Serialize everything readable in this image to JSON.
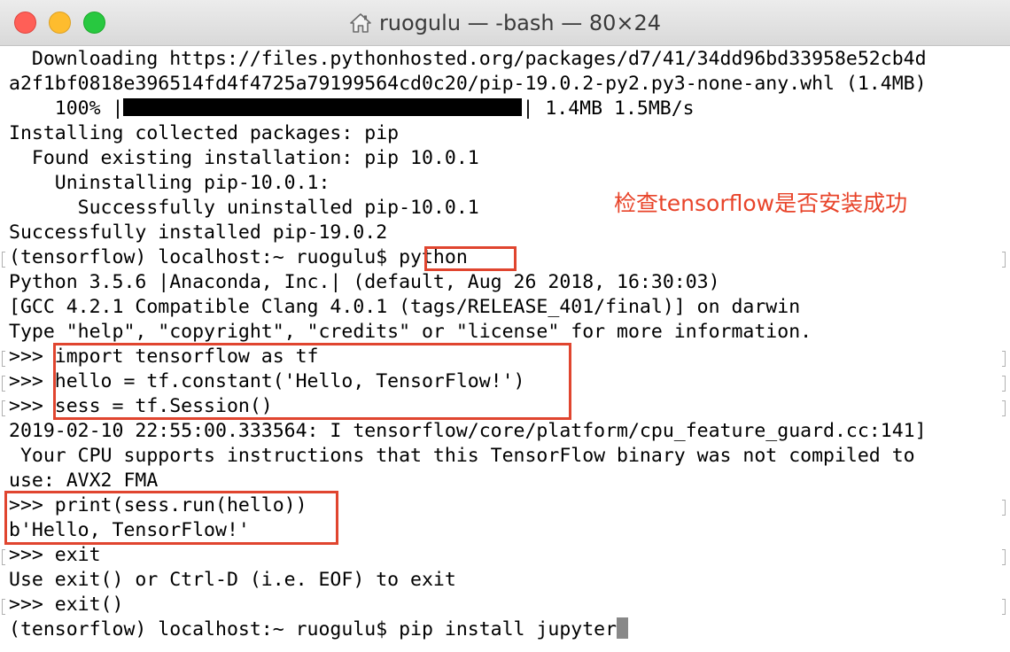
{
  "window": {
    "title": "ruogulu — -bash — 80×24",
    "title_icon": "home-icon"
  },
  "terminal": {
    "lines": [
      "  Downloading https://files.pythonhosted.org/packages/d7/41/34dd96bd33958e52cb4d",
      "a2f1bf0818e396514fd4f4725a79199564cd0c20/pip-19.0.2-py2.py3-none-any.whl (1.4MB)",
      "",
      "Installing collected packages: pip",
      "  Found existing installation: pip 10.0.1",
      "    Uninstalling pip-10.0.1:",
      "      Successfully uninstalled pip-10.0.1",
      "Successfully installed pip-19.0.2",
      "(tensorflow) localhost:~ ruogulu$ python",
      "Python 3.5.6 |Anaconda, Inc.| (default, Aug 26 2018, 16:30:03)",
      "[GCC 4.2.1 Compatible Clang 4.0.1 (tags/RELEASE_401/final)] on darwin",
      "Type \"help\", \"copyright\", \"credits\" or \"license\" for more information.",
      ">>> import tensorflow as tf",
      ">>> hello = tf.constant('Hello, TensorFlow!')",
      ">>> sess = tf.Session()",
      "2019-02-10 22:55:00.333564: I tensorflow/core/platform/cpu_feature_guard.cc:141]",
      " Your CPU supports instructions that this TensorFlow binary was not compiled to",
      "use: AVX2 FMA",
      ">>> print(sess.run(hello))",
      "b'Hello, TensorFlow!'",
      ">>> exit",
      "Use exit() or Ctrl-D (i.e. EOF) to exit",
      ">>> exit()",
      "(tensorflow) localhost:~ ruogulu$ pip install jupyter"
    ],
    "progress": {
      "percent_label": "    100% |",
      "fraction": 1.0,
      "suffix": "| 1.4MB 1.5MB/s"
    }
  },
  "annotation": {
    "text": "检查tensorflow是否安装成功",
    "color": "#e8442a"
  }
}
